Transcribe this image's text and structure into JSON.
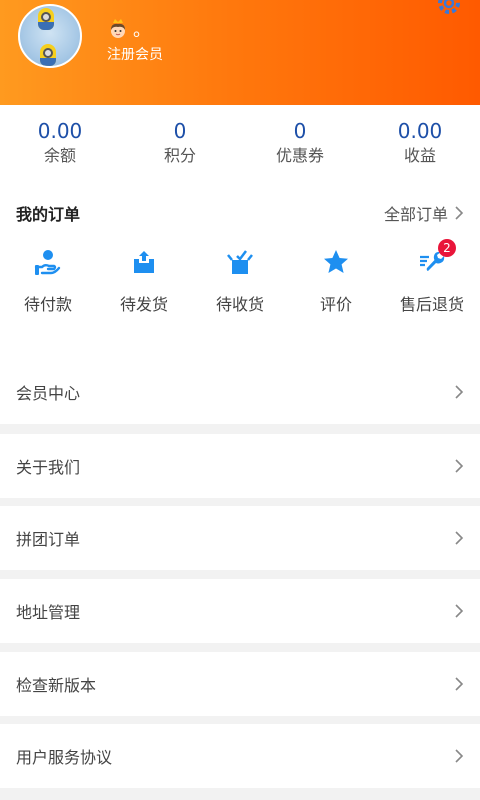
{
  "user": {
    "nickname": "。",
    "level": "注册会员",
    "avatar_icon": "minion-avatar",
    "nickname_emoji_icon": "princess-face-icon"
  },
  "stats": [
    {
      "value": "0.00",
      "label": "余额"
    },
    {
      "value": "0",
      "label": "积分"
    },
    {
      "value": "0",
      "label": "优惠券"
    },
    {
      "value": "0.00",
      "label": "收益"
    }
  ],
  "orders": {
    "title": "我的订单",
    "all_label": "全部订单",
    "items": [
      {
        "label": "待付款",
        "icon": "hand-money-icon"
      },
      {
        "label": "待发货",
        "icon": "box-upload-icon"
      },
      {
        "label": "待收货",
        "icon": "box-open-icon"
      },
      {
        "label": "评价",
        "icon": "star-icon"
      },
      {
        "label": "售后退货",
        "icon": "wrench-icon",
        "badge": "2"
      }
    ]
  },
  "menu": [
    {
      "label": "会员中心"
    },
    {
      "label": "关于我们"
    },
    {
      "label": "拼团订单"
    },
    {
      "label": "地址管理"
    },
    {
      "label": "检查新版本"
    },
    {
      "label": "用户服务协议"
    }
  ],
  "colors": {
    "header_start": "#ff9a1f",
    "header_end": "#ff5a00",
    "stat_value": "#1d4fa8",
    "icon_blue": "#1e8ff0",
    "badge": "#e9153a"
  }
}
